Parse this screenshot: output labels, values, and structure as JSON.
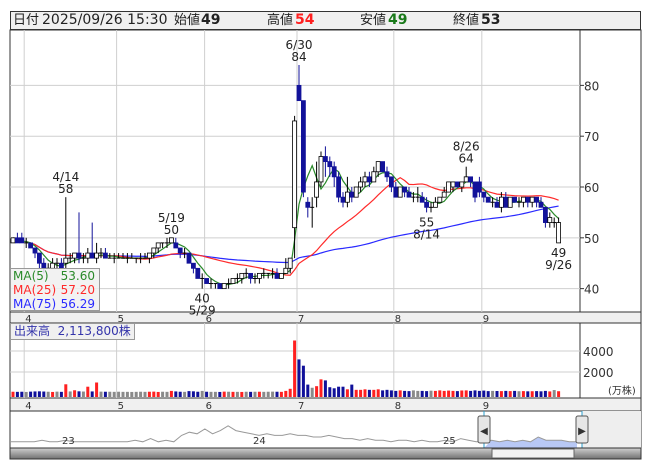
{
  "header": {
    "date_label": "日付",
    "date": "2025/09/26 15:30",
    "open_label": "始値",
    "open": "49",
    "high_label": "高値",
    "high": "54",
    "low_label": "安値",
    "low": "49",
    "close_label": "終値",
    "close": "53"
  },
  "legend": {
    "ma5_label": "MA(5)",
    "ma5": "53.60",
    "ma25_label": "MA(25)",
    "ma25": "57.20",
    "ma75_label": "MA(75)",
    "ma75": "56.29"
  },
  "volume": {
    "label": "出来高",
    "value": "2,113,800株",
    "unit": "(万株)"
  },
  "colors": {
    "up": "#ffffff",
    "down": "#12129a",
    "ma5": "#2a8a2a",
    "ma25": "#ff2a2a",
    "ma75": "#2a2aff",
    "vol_up": "#ff2020",
    "vol_down": "#10109a",
    "vol_flat": "#8a8a8a"
  },
  "chart_data": {
    "type": "candlestick",
    "price_axis": {
      "ticks": [
        "40",
        "50",
        "60",
        "70",
        "80"
      ],
      "range": [
        35.4,
        90.9
      ]
    },
    "volume_axis": {
      "ticks": [
        "2000",
        "4000"
      ],
      "range": [
        0,
        6600
      ]
    },
    "months": [
      {
        "label": "4",
        "index": 3
      },
      {
        "label": "5",
        "index": 24
      },
      {
        "label": "6",
        "index": 44
      },
      {
        "label": "7",
        "index": 65
      },
      {
        "label": "8",
        "index": 87
      },
      {
        "label": "9",
        "index": 107
      }
    ],
    "candles": [
      [
        49,
        50,
        49,
        50
      ],
      [
        50,
        51,
        49,
        49
      ],
      [
        50,
        51,
        49,
        49
      ],
      [
        49,
        50,
        48,
        49
      ],
      [
        49,
        49,
        48,
        48
      ],
      [
        48,
        48,
        46,
        47
      ],
      [
        47,
        47,
        44,
        45
      ],
      [
        45,
        46,
        43,
        44
      ],
      [
        44,
        45,
        44,
        44
      ],
      [
        44,
        46,
        44,
        45
      ],
      [
        45,
        46,
        44,
        45
      ],
      [
        45,
        46,
        44,
        44
      ],
      [
        45,
        58,
        44,
        46
      ],
      [
        46,
        47,
        45,
        46
      ],
      [
        46,
        47,
        45,
        47
      ],
      [
        47,
        55,
        45,
        46
      ],
      [
        46,
        47,
        45,
        46
      ],
      [
        46,
        48,
        45,
        47
      ],
      [
        47,
        53,
        46,
        46
      ],
      [
        46,
        49,
        45,
        47
      ],
      [
        47,
        48,
        46,
        47
      ],
      [
        47,
        48,
        46,
        46
      ],
      [
        46,
        47,
        46,
        46
      ],
      [
        46,
        47,
        45,
        46
      ],
      [
        46,
        47,
        46,
        46
      ],
      [
        46,
        47,
        46,
        46
      ],
      [
        46,
        47,
        45,
        46
      ],
      [
        46,
        47,
        46,
        46
      ],
      [
        46,
        46,
        45,
        46
      ],
      [
        46,
        47,
        45,
        46
      ],
      [
        46,
        47,
        46,
        46
      ],
      [
        46,
        47,
        45,
        47
      ],
      [
        47,
        48,
        46,
        48
      ],
      [
        48,
        49,
        47,
        49
      ],
      [
        49,
        49,
        48,
        49
      ],
      [
        49,
        50,
        48,
        49
      ],
      [
        49,
        50,
        49,
        50
      ],
      [
        49,
        50,
        48,
        48
      ],
      [
        48,
        48,
        46,
        47
      ],
      [
        47,
        48,
        46,
        47
      ],
      [
        47,
        47,
        45,
        45
      ],
      [
        45,
        45,
        43,
        44
      ],
      [
        44,
        44,
        42,
        42
      ],
      [
        42,
        43,
        40,
        42
      ],
      [
        42,
        42,
        41,
        41
      ],
      [
        41,
        42,
        40,
        41
      ],
      [
        41,
        41,
        40,
        41
      ],
      [
        41,
        41,
        40,
        40
      ],
      [
        40,
        41,
        40,
        41
      ],
      [
        41,
        42,
        40,
        41
      ],
      [
        41,
        42,
        41,
        42
      ],
      [
        42,
        43,
        41,
        42
      ],
      [
        42,
        43,
        41,
        43
      ],
      [
        43,
        44,
        42,
        43
      ],
      [
        43,
        43,
        41,
        42
      ],
      [
        42,
        43,
        41,
        42
      ],
      [
        42,
        43,
        41,
        43
      ],
      [
        43,
        44,
        42,
        43
      ],
      [
        43,
        43,
        42,
        43
      ],
      [
        43,
        44,
        42,
        43
      ],
      [
        43,
        44,
        42,
        42
      ],
      [
        42,
        43,
        42,
        43
      ],
      [
        43,
        46,
        43,
        44
      ],
      [
        44,
        46,
        43,
        46
      ],
      [
        52,
        74,
        46,
        73
      ],
      [
        80,
        84,
        77,
        77
      ],
      [
        77,
        77,
        58,
        59
      ],
      [
        57,
        58,
        54,
        56
      ],
      [
        56,
        58,
        52,
        56
      ],
      [
        58,
        65,
        56,
        61
      ],
      [
        61,
        67,
        60,
        66
      ],
      [
        66,
        68,
        62,
        65
      ],
      [
        65,
        66,
        62,
        64
      ],
      [
        64,
        65,
        60,
        62
      ],
      [
        62,
        63,
        57,
        58
      ],
      [
        58,
        59,
        56,
        57
      ],
      [
        57,
        62,
        56,
        59
      ],
      [
        59,
        60,
        57,
        58
      ],
      [
        58,
        60,
        58,
        60
      ],
      [
        60,
        62,
        59,
        61
      ],
      [
        61,
        63,
        60,
        62
      ],
      [
        62,
        63,
        60,
        61
      ],
      [
        61,
        64,
        61,
        63
      ],
      [
        63,
        65,
        62,
        65
      ],
      [
        65,
        65,
        63,
        63
      ],
      [
        63,
        64,
        61,
        62
      ],
      [
        62,
        62,
        59,
        60
      ],
      [
        60,
        61,
        58,
        58
      ],
      [
        58,
        60,
        58,
        60
      ],
      [
        60,
        60,
        58,
        59
      ],
      [
        59,
        60,
        58,
        58
      ],
      [
        58,
        59,
        57,
        58
      ],
      [
        58,
        60,
        57,
        58
      ],
      [
        58,
        59,
        57,
        57
      ],
      [
        57,
        58,
        55,
        56
      ],
      [
        56,
        57,
        55,
        56
      ],
      [
        56,
        58,
        56,
        57
      ],
      [
        57,
        58,
        57,
        58
      ],
      [
        58,
        60,
        58,
        59
      ],
      [
        59,
        61,
        59,
        61
      ],
      [
        60,
        61,
        59,
        61
      ],
      [
        61,
        61,
        60,
        60
      ],
      [
        60,
        61,
        59,
        61
      ],
      [
        61,
        64,
        61,
        62
      ],
      [
        62,
        62,
        60,
        61
      ],
      [
        61,
        61,
        57,
        58
      ],
      [
        61,
        62,
        58,
        59
      ],
      [
        59,
        59,
        57,
        58
      ],
      [
        58,
        58,
        57,
        57
      ],
      [
        57,
        58,
        56,
        57
      ],
      [
        57,
        58,
        56,
        56
      ],
      [
        56,
        59,
        55,
        58
      ],
      [
        58,
        59,
        56,
        56
      ],
      [
        56,
        58,
        56,
        58
      ],
      [
        58,
        58,
        57,
        57
      ],
      [
        57,
        58,
        56,
        57
      ],
      [
        57,
        58,
        56,
        58
      ],
      [
        58,
        58,
        56,
        57
      ],
      [
        57,
        58,
        56,
        58
      ],
      [
        58,
        58,
        56,
        57
      ],
      [
        57,
        58,
        56,
        56
      ],
      [
        56,
        56,
        52,
        53
      ],
      [
        53,
        55,
        52,
        54
      ],
      [
        53,
        54,
        52,
        53
      ],
      [
        49,
        54,
        49,
        53
      ]
    ],
    "volumes": [
      120,
      110,
      120,
      100,
      130,
      150,
      160,
      140,
      120,
      100,
      130,
      110,
      830,
      150,
      260,
      160,
      140,
      600,
      150,
      1000,
      130,
      120,
      120,
      110,
      120,
      110,
      110,
      100,
      110,
      120,
      110,
      120,
      130,
      100,
      120,
      110,
      200,
      150,
      120,
      110,
      180,
      160,
      120,
      200,
      120,
      110,
      110,
      100,
      130,
      120,
      110,
      110,
      100,
      120,
      110,
      120,
      120,
      110,
      120,
      130,
      120,
      110,
      200,
      400,
      5000,
      3200,
      2600,
      800,
      500,
      650,
      1300,
      1200,
      550,
      450,
      600,
      600,
      350,
      800,
      300,
      300,
      350,
      300,
      300,
      350,
      250,
      300,
      250,
      200,
      250,
      200,
      180,
      250,
      200,
      200,
      180,
      220,
      200,
      250,
      200,
      230,
      200,
      180,
      240,
      250,
      200,
      250,
      200,
      230,
      180,
      200,
      190,
      180,
      200,
      180,
      200,
      170,
      180,
      160,
      170,
      180,
      160,
      200,
      150,
      280,
      170
    ],
    "annotations": [
      {
        "index": 65,
        "date": "6/30",
        "value": "84",
        "pos": "above"
      },
      {
        "index": 12,
        "date": "4/14",
        "value": "58",
        "pos": "above"
      },
      {
        "index": 36,
        "date": "5/19",
        "value": "50",
        "pos": "above"
      },
      {
        "index": 43,
        "date": "5/29",
        "value": "40",
        "pos": "below"
      },
      {
        "index": 103,
        "date": "8/26",
        "value": "64",
        "pos": "above"
      },
      {
        "index": 94,
        "date": "8/14",
        "value": "55",
        "pos": "below"
      },
      {
        "index": 124,
        "date": "9/26",
        "value": "49",
        "pos": "below"
      }
    ]
  },
  "navigator": {
    "year_labels": [
      "23",
      "24",
      "25"
    ],
    "series": [
      30,
      30,
      30,
      30,
      31,
      30,
      30,
      31,
      30,
      30,
      30,
      30,
      30,
      30,
      30,
      30,
      31,
      30,
      32,
      30,
      31,
      30,
      34,
      36,
      35,
      38,
      35,
      37,
      40,
      37,
      36,
      35,
      34,
      35,
      34,
      34,
      35,
      34,
      34,
      33,
      33,
      34,
      33,
      32,
      32,
      31,
      32,
      31,
      31,
      30,
      31,
      31,
      30,
      31,
      30,
      30,
      31,
      30,
      32,
      31,
      30,
      30,
      31,
      30,
      31,
      30,
      31,
      30,
      33,
      31,
      31,
      31,
      30,
      30
    ]
  }
}
